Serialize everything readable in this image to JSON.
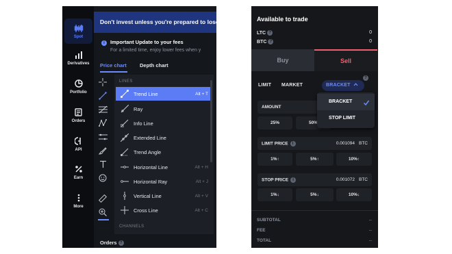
{
  "sidebar": {
    "items": [
      {
        "label": "Spot",
        "icon": "spot-chart-icon",
        "active": true
      },
      {
        "label": "Derivatives",
        "icon": "bar-chart-icon"
      },
      {
        "label": "Portfolio",
        "icon": "pie-chart-icon"
      },
      {
        "label": "Orders",
        "icon": "document-icon"
      },
      {
        "label": "API",
        "icon": "api-icon"
      },
      {
        "label": "Earn",
        "icon": "percent-icon"
      },
      {
        "label": "More",
        "icon": "more-dots-icon"
      }
    ]
  },
  "banner": {
    "text": "Don't invest unless you're prepared to lose"
  },
  "notice": {
    "title": "Important Update to your fees",
    "subtitle": "For a limited time, enjoy lower fees when y"
  },
  "chart_tabs": {
    "price": "Price chart",
    "depth": "Depth chart"
  },
  "dropdown": {
    "section_lines": "LINES",
    "section_channels": "CHANNELS",
    "items": [
      {
        "label": "Trend Line",
        "shortcut": "Alt + T",
        "selected": true
      },
      {
        "label": "Ray",
        "shortcut": ""
      },
      {
        "label": "Info Line",
        "shortcut": ""
      },
      {
        "label": "Extended Line",
        "shortcut": ""
      },
      {
        "label": "Trend Angle",
        "shortcut": ""
      },
      {
        "label": "Horizontal Line",
        "shortcut": "Alt + H"
      },
      {
        "label": "Horizontal Ray",
        "shortcut": "Alt + J"
      },
      {
        "label": "Vertical Line",
        "shortcut": "Alt + V"
      },
      {
        "label": "Cross Line",
        "shortcut": "Alt + C"
      }
    ]
  },
  "orders_footer": {
    "label": "Orders"
  },
  "trade": {
    "title": "Available to trade",
    "balances": [
      {
        "asset": "LTC",
        "value": "0"
      },
      {
        "asset": "BTC",
        "value": "0"
      }
    ],
    "buy_label": "Buy",
    "sell_label": "Sell",
    "order_types": {
      "limit": "LIMIT",
      "market": "MARKET",
      "bracket": "BRACKET"
    },
    "popover": {
      "bracket": "BRACKET",
      "stop_limit": "STOP LIMIT"
    },
    "amount_label": "AMOUNT",
    "amount_pcts": [
      "25%",
      "50%"
    ],
    "limit_price": {
      "label": "LIMIT PRICE",
      "value": "0.001094",
      "unit": "BTC"
    },
    "limit_pcts": [
      "1%↑",
      "5%↑",
      "10%↑"
    ],
    "stop_price": {
      "label": "STOP PRICE",
      "value": "0.001072",
      "unit": "BTC"
    },
    "stop_pcts": [
      "1%↓",
      "5%↓",
      "10%↓"
    ],
    "summary": [
      {
        "label": "SUBTOTAL",
        "value": "--"
      },
      {
        "label": "FEE",
        "value": "--"
      },
      {
        "label": "TOTAL",
        "value": "--"
      }
    ]
  },
  "colors": {
    "accent": "#5b7cf5",
    "sell": "#f0616d",
    "banner": "#1f3580"
  }
}
